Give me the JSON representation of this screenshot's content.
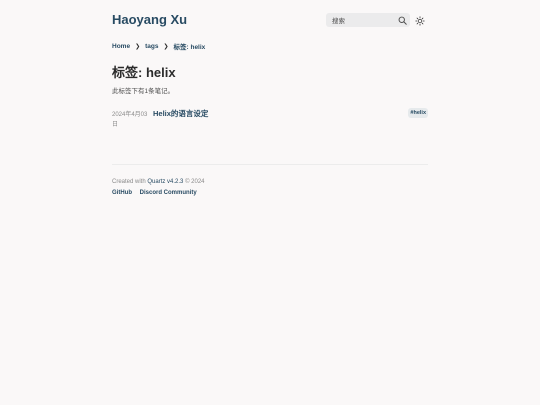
{
  "header": {
    "site_title": "Haoyang Xu",
    "search_placeholder": "搜索",
    "search_icon": "search-icon",
    "theme_icon": "sun-icon"
  },
  "breadcrumb": {
    "items": [
      "Home",
      "tags",
      "标签: helix"
    ],
    "separator": "❯"
  },
  "main": {
    "title": "标签: helix",
    "description": "此标签下有1条笔记。",
    "notes": [
      {
        "date": "2024年4月03日",
        "title": "Helix的语言设定",
        "tag": "#helix"
      }
    ]
  },
  "footer": {
    "created_prefix": "Created with",
    "quartz_label": "Quartz v4.2.3",
    "created_suffix": "© 2024",
    "links": [
      "GitHub",
      "Discord Community"
    ]
  },
  "colors": {
    "background": "#faf8f8",
    "accent": "#284b63",
    "text": "#2b2b2b",
    "muted": "#8a8a8a",
    "search_bg": "#ebebec",
    "tag_bg": "#e6eaec"
  }
}
